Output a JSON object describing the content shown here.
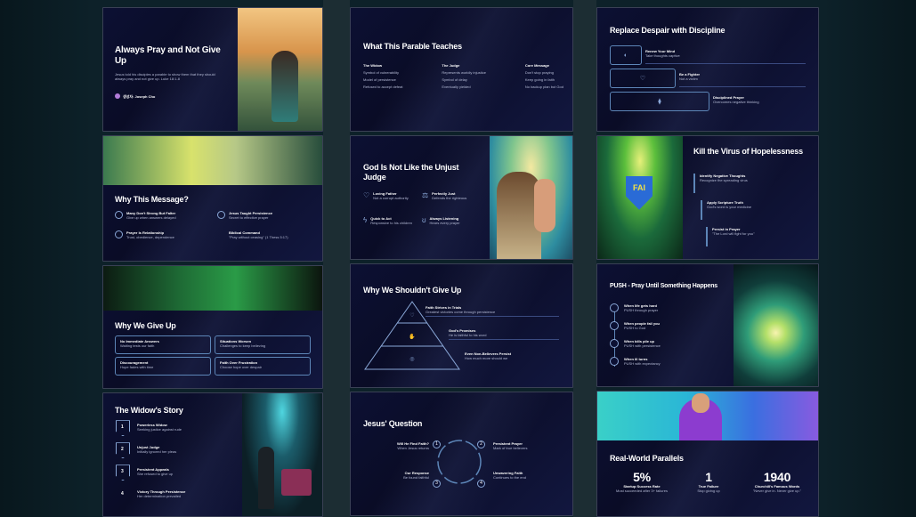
{
  "col1": {
    "s1": {
      "title": "Always Pray and Not Give Up",
      "body": "Jesus told his disciples a parable to show them that they should always pray and not give up. Luke 18:1-8",
      "author": "생성자: Joseph Cho"
    },
    "s2": {
      "title": "Why This Message?",
      "items": [
        {
          "head": "Many Don't Strong But Falter",
          "sub": "Give up when answers delayed"
        },
        {
          "head": "Jesus Taught Persistence",
          "sub": "Secret to effective prayer"
        },
        {
          "head": "Prayer Is Relationship",
          "sub": "Trust, obedience, dependence"
        },
        {
          "head": "Biblical Command",
          "sub": "\"Pray without ceasing\" (1 Thess 5:17)"
        }
      ]
    },
    "s3": {
      "title": "Why We Give Up",
      "boxes": [
        {
          "head": "No Immediate Answers",
          "sub": "Waiting tests our faith"
        },
        {
          "head": "Situations Worsen",
          "sub": "Challenges to keep believing"
        },
        {
          "head": "Discouragement",
          "sub": "Hope fades with time"
        },
        {
          "head": "Faith Over Frustration",
          "sub": "Choose hope over despair"
        }
      ]
    },
    "s4": {
      "title": "The Widow's Story",
      "steps": [
        {
          "n": "1",
          "head": "Powerless Widow",
          "sub": "Seeking justice against rude"
        },
        {
          "n": "2",
          "head": "Unjust Judge",
          "sub": "Initially ignored her pleas"
        },
        {
          "n": "3",
          "head": "Persistent Appeals",
          "sub": "She refused to give up"
        },
        {
          "n": "4",
          "head": "Victory Through Persistence",
          "sub": "Her determination prevailed"
        }
      ]
    }
  },
  "col2": {
    "s1": {
      "title": "What This Parable Teaches",
      "cols": [
        {
          "head": "The Widow",
          "rows": [
            "Symbol of vulnerability",
            "Model of persistence",
            "Refused to accept defeat"
          ]
        },
        {
          "head": "The Judge",
          "rows": [
            "Represents worldly injustice",
            "Symbol of delay",
            "Eventually yielded"
          ]
        },
        {
          "head": "Core Message",
          "rows": [
            "Don't stop praying",
            "Keep going in faith",
            "No backup plan but God"
          ]
        }
      ]
    },
    "s2": {
      "title": "God Is Not Like the Unjust Judge",
      "items": [
        {
          "head": "Loving Father",
          "sub": "Not a corrupt authority"
        },
        {
          "head": "Perfectly Just",
          "sub": "Defends the righteous"
        },
        {
          "head": "Quick to Act",
          "sub": "Responsive to his children"
        },
        {
          "head": "Always Listening",
          "sub": "Hears every prayer"
        }
      ]
    },
    "s3": {
      "title": "Why We Shouldn't Give Up",
      "levels": [
        {
          "head": "Faith Strives in Trials",
          "sub": "Greatest victories come through persistence"
        },
        {
          "head": "God's Promises",
          "sub": "He is faithful to his word"
        },
        {
          "head": "Even Non-Believers Persist",
          "sub": "How much more should we"
        }
      ]
    },
    "s4": {
      "title": "Jesus' Question",
      "items": [
        {
          "n": "1",
          "head": "Will He Find Faith?",
          "sub": "When Jesus returns"
        },
        {
          "n": "2",
          "head": "Persistent Prayer",
          "sub": "Mark of true believers"
        },
        {
          "n": "3",
          "head": "Our Response",
          "sub": "Be found faithful"
        },
        {
          "n": "4",
          "head": "Unwavering Faith",
          "sub": "Continues to the end"
        }
      ]
    }
  },
  "col3": {
    "s1": {
      "title": "Replace Despair with Discipline",
      "rows": [
        {
          "head": "Renew Your Mind",
          "sub": "Take thoughts captive"
        },
        {
          "head": "Be a Fighter",
          "sub": "Not a victim"
        },
        {
          "head": "Disciplined Prayer",
          "sub": "Overcomes negative thinking"
        }
      ]
    },
    "s2": {
      "title": "Kill the Virus of Hopelessness",
      "shield": "FAI",
      "items": [
        {
          "head": "Identify Negative Thoughts",
          "sub": "Recognize the spreading virus"
        },
        {
          "head": "Apply Scripture Truth",
          "sub": "God's word is your medicine"
        },
        {
          "head": "Persist in Prayer",
          "sub": "\"The Lord will fight for you\""
        }
      ]
    },
    "s3": {
      "title": "PUSH - Pray Until Something Happens",
      "items": [
        {
          "head": "When life gets hard",
          "sub": "PUSH through prayer"
        },
        {
          "head": "When people fail you",
          "sub": "PUSH to God"
        },
        {
          "head": "When bills pile up",
          "sub": "PUSH with persistence"
        },
        {
          "head": "When ill turns",
          "sub": "PUSH with expectancy"
        }
      ]
    },
    "s4": {
      "title": "Real-World Parallels",
      "stats": [
        {
          "value": "5%",
          "label": "Startup Success Rate",
          "sub": "Most succeeded after 3+ failures"
        },
        {
          "value": "1",
          "label": "True Failure",
          "sub": "Stop giving up"
        },
        {
          "value": "1940",
          "label": "Churchill's Famous Words",
          "sub": "\"Never give in. Never give up.\""
        }
      ]
    }
  },
  "colors": {
    "accent": "#8aa8d8",
    "slide_bg": "#0c1033",
    "page_bg": "#0d2129"
  }
}
